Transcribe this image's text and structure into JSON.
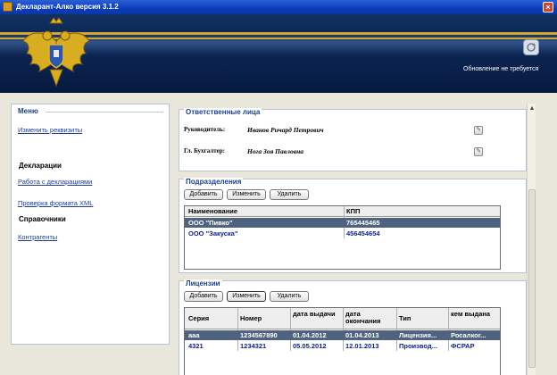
{
  "window": {
    "title": "Декларант-Алко версия 3.1.2",
    "close_label": "×"
  },
  "banner": {
    "update_status": "Обновление не требуется"
  },
  "sidebar": {
    "menu_title": "Меню",
    "edit_requisites": "Изменить реквизиты",
    "declarations_title": "Декларации",
    "work_with_declarations": "Работа с декларациями",
    "check_xml": "Проверка формата XML",
    "references_title": "Справочники",
    "contractors": "Контрагенты"
  },
  "responsible": {
    "title": "Ответственные лица",
    "director_label": "Руководитель:",
    "director_value": "Иванов Ричард Петрович",
    "accountant_label": "Гл. Бухгалтер:",
    "accountant_value": "Нога Зоя Павловна",
    "edit_glyph": "✎"
  },
  "divisions": {
    "title": "Подразделения",
    "add_label": "Добавить",
    "edit_label": "Изменить",
    "delete_label": "Удалить",
    "columns": [
      "Наименование",
      "КПП"
    ],
    "rows": [
      [
        "ООО \"Пивко\"",
        "765445465"
      ],
      [
        "ООО \"Закуска\"",
        "456454654"
      ]
    ]
  },
  "licenses": {
    "title": "Лицензии",
    "add_label": "Добавить",
    "edit_label": "Изменить",
    "delete_label": "Удалить",
    "columns": [
      "Серия",
      "Номер",
      "дата выдачи",
      "дата окончания",
      "Тип",
      "кем выдана"
    ],
    "rows": [
      [
        "aaa",
        "1234567890",
        "01.04.2012",
        "01.04.2013",
        "Лицензия...",
        "Росалког..."
      ],
      [
        "4321",
        "1234321",
        "05.05.2012",
        "12.01.2013",
        "Производ...",
        "ФСРАР"
      ]
    ]
  },
  "colors": {
    "banner": "#0d2a57",
    "accent": "#d3a62c",
    "selected_row": "#4f6380",
    "link": "#1d3c9a"
  },
  "icons": [
    "app-icon",
    "close-icon",
    "coat-of-arms-emblem",
    "refresh-icon",
    "edit-icon",
    "scroll-up-arrow-icon"
  ]
}
